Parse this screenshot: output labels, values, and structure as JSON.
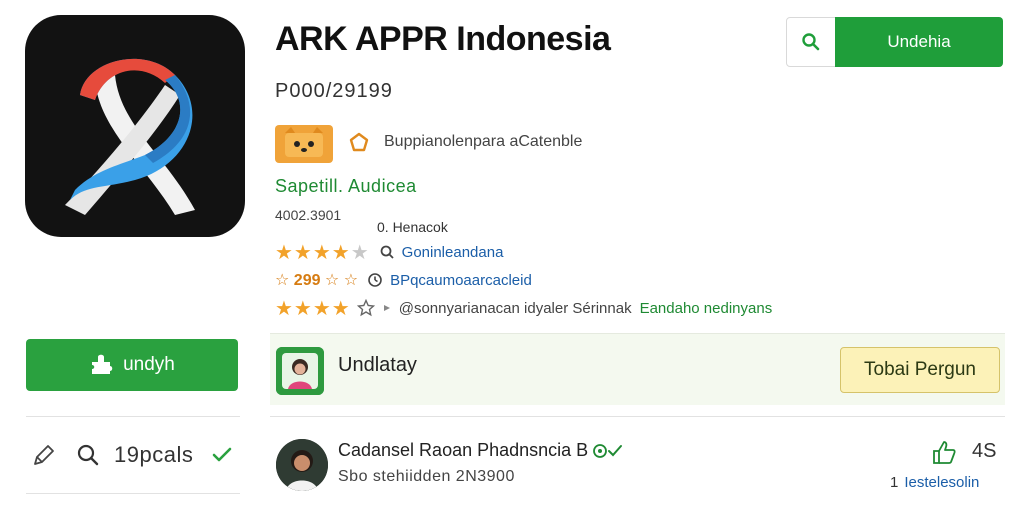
{
  "app": {
    "title": "ARK APPR Indonesia",
    "code": "P000/29199",
    "developer": "Buppianolenpara aCatenble",
    "subtitle": "Sapetill. Audicea",
    "meta_code": "4002.3901",
    "meta_label": "0. Henacok"
  },
  "header": {
    "button_label": "Undehia",
    "search_icon": "search-icon"
  },
  "ratings": [
    {
      "stars": 4,
      "value": "",
      "icon": "search-icon",
      "text": "Goninleandana",
      "color": "blue"
    },
    {
      "stars": 0,
      "value": "☆ 299 ☆ ☆",
      "icon": "clock-icon",
      "text": "BPqcaumoaarcacleid",
      "color": "blue"
    },
    {
      "stars": 4,
      "value": "",
      "icon": "star-outline-icon",
      "text": "@sonnyarianacan idyaler Sérinnak",
      "extra": "Eandaho nedinyans",
      "color": "gray"
    }
  ],
  "left": {
    "download_label": "undyh",
    "tools_label": "19pcals"
  },
  "promo": {
    "title": "Undlatay",
    "button_label": "Tobai Pergun"
  },
  "review": {
    "name": "Cadansel Raoan Phadnsncia B",
    "sub": "Sbo stehiidden 2N3900",
    "likes": "4S",
    "footer_num": "1",
    "footer_text": "Iestelesolin"
  },
  "colors": {
    "primary_green": "#1f9e3a",
    "download_green": "#2aa13f",
    "star_orange": "#f2a22a",
    "link_blue": "#1b5ea8",
    "promo_button": "#fcf2b8"
  }
}
